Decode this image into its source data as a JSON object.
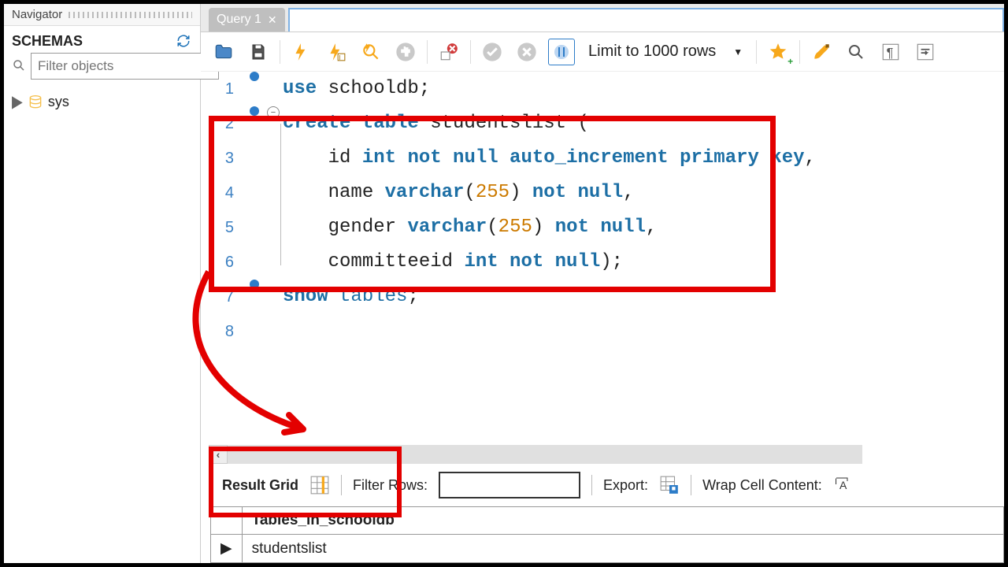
{
  "navigator": {
    "title": "Navigator",
    "schemas_label": "SCHEMAS",
    "filter_placeholder": "Filter objects",
    "tree_item": "sys"
  },
  "tab": {
    "label": "Query 1"
  },
  "toolbar": {
    "limit_label": "Limit to 1000 rows"
  },
  "editor": {
    "lines": [
      {
        "n": "1",
        "dot": true,
        "fold": "",
        "text": [
          [
            "kw",
            "use "
          ],
          [
            "id",
            "schooldb"
          ],
          [
            "",
            ";"
          ]
        ]
      },
      {
        "n": "2",
        "dot": true,
        "fold": "−",
        "text": [
          [
            "kw",
            "create table "
          ],
          [
            "id",
            "studentslist"
          ],
          [
            "",
            " ("
          ]
        ]
      },
      {
        "n": "3",
        "dot": false,
        "fold": "",
        "text": [
          [
            "",
            "    "
          ],
          [
            "id",
            "id "
          ],
          [
            "kw",
            "int not null auto_increment primary key"
          ],
          [
            "",
            ","
          ]
        ]
      },
      {
        "n": "4",
        "dot": false,
        "fold": "",
        "text": [
          [
            "",
            "    "
          ],
          [
            "id",
            "name "
          ],
          [
            "kw",
            "varchar"
          ],
          [
            "",
            "("
          ],
          [
            "num",
            "255"
          ],
          [
            "",
            ") "
          ],
          [
            "kw",
            "not null"
          ],
          [
            "",
            ","
          ]
        ]
      },
      {
        "n": "5",
        "dot": false,
        "fold": "",
        "text": [
          [
            "",
            "    "
          ],
          [
            "id",
            "gender "
          ],
          [
            "kw",
            "varchar"
          ],
          [
            "",
            "("
          ],
          [
            "num",
            "255"
          ],
          [
            "",
            ") "
          ],
          [
            "kw",
            "not null"
          ],
          [
            "",
            ","
          ]
        ]
      },
      {
        "n": "6",
        "dot": false,
        "fold": "",
        "text": [
          [
            "",
            "    "
          ],
          [
            "id",
            "committeeid "
          ],
          [
            "kw",
            "int not null"
          ],
          [
            "",
            ");"
          ]
        ]
      },
      {
        "n": "7",
        "dot": true,
        "fold": "",
        "text": [
          [
            "kw",
            "show "
          ],
          [
            "fn",
            "tables"
          ],
          [
            "",
            ";"
          ]
        ]
      },
      {
        "n": "8",
        "dot": false,
        "fold": "",
        "text": [
          [
            "",
            ""
          ]
        ]
      }
    ]
  },
  "result": {
    "grid_label": "Result Grid",
    "filter_rows_label": "Filter Rows:",
    "export_label": "Export:",
    "wrap_label": "Wrap Cell Content:",
    "column": "Tables_in_schooldb",
    "row_value": "studentslist"
  }
}
